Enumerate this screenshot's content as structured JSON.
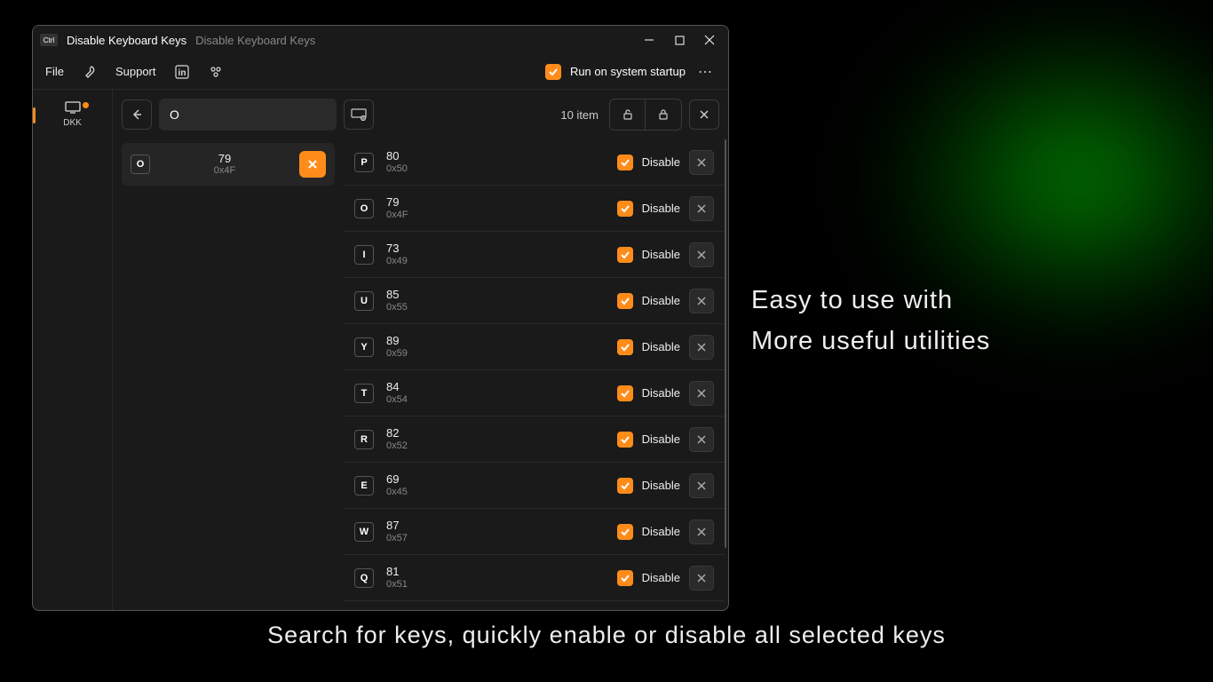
{
  "titlebar": {
    "icon_label": "Ctrl",
    "title": "Disable Keyboard Keys",
    "subtitle": "Disable Keyboard Keys"
  },
  "menubar": {
    "file": "File",
    "support": "Support",
    "startup_label": "Run on system startup"
  },
  "sidebar": {
    "label": "DKK"
  },
  "toolbar": {
    "search_value": "O",
    "item_count": "10 item"
  },
  "search_result": {
    "key": "O",
    "code": "79",
    "hex": "0x4F"
  },
  "keys": [
    {
      "key": "P",
      "code": "80",
      "hex": "0x50",
      "label": "Disable"
    },
    {
      "key": "O",
      "code": "79",
      "hex": "0x4F",
      "label": "Disable"
    },
    {
      "key": "I",
      "code": "73",
      "hex": "0x49",
      "label": "Disable"
    },
    {
      "key": "U",
      "code": "85",
      "hex": "0x55",
      "label": "Disable"
    },
    {
      "key": "Y",
      "code": "89",
      "hex": "0x59",
      "label": "Disable"
    },
    {
      "key": "T",
      "code": "84",
      "hex": "0x54",
      "label": "Disable"
    },
    {
      "key": "R",
      "code": "82",
      "hex": "0x52",
      "label": "Disable"
    },
    {
      "key": "E",
      "code": "69",
      "hex": "0x45",
      "label": "Disable"
    },
    {
      "key": "W",
      "code": "87",
      "hex": "0x57",
      "label": "Disable"
    },
    {
      "key": "Q",
      "code": "81",
      "hex": "0x51",
      "label": "Disable"
    }
  ],
  "promo": {
    "side_line1": "Easy to use with",
    "side_line2": "More useful utilities",
    "bottom": "Search for keys, quickly enable or disable all selected keys"
  }
}
